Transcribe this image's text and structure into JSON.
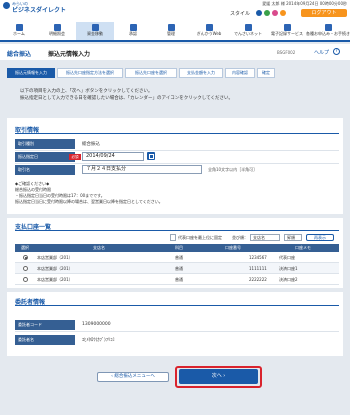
{
  "brand": {
    "sub": "みらいの",
    "name": "ビジネスダイレクト"
  },
  "header": {
    "user_info": "愛媛 太郎 様 2014年09月24日 00時00分00秒",
    "style_label": "スタイル",
    "logout": "ログアウト"
  },
  "nav": [
    {
      "label": "ホーム"
    },
    {
      "label": "明細照会"
    },
    {
      "label": "資金移動"
    },
    {
      "label": "承認"
    },
    {
      "label": "管理"
    },
    {
      "label": "ぎんかうWeb"
    },
    {
      "label": "でんさいネット"
    },
    {
      "label": "電子記録サービス"
    },
    {
      "label": "各種お申込み・お手続き"
    }
  ],
  "page": {
    "section": "総合振込",
    "title": "振込元情報入力",
    "code": "BSGF002",
    "help": "ヘルプ",
    "help_symbol": "?"
  },
  "steps": [
    "振込元情報を入力",
    "振込先口座指定方法を選択",
    "振込先口座を選択",
    "支払金額を入力",
    "内容確認",
    "確定"
  ],
  "instructions": [
    "以下の項目を入力の上、「次へ」ボタンをクリックしてください。",
    "振込指定日として入力できる日を確認したい場合は、「カレンダー」のアイコンをクリックしてください。"
  ],
  "transaction": {
    "title": "取引情報",
    "type_label": "取引種別",
    "type_value": "総合振込",
    "date_label": "振込指定日",
    "required": "必須",
    "date_value": "2014/09/24",
    "name_label": "取引名",
    "name_value": "７月２４日支払分",
    "name_hint": "全角10文字以内［半角可］"
  },
  "notes": [
    "◆ご確認ください◆",
    "総合振込の受付時限",
    "・振込指定日当日の受付時限は17：00までです。",
    "振込指定日当日に受付時限以降の場合は、翌営業日以降を指定日としてください。"
  ],
  "account_list": {
    "title": "支払口座一覧",
    "checkbox_label": "代表口座を最上位に固定",
    "sort_label": "並び順：",
    "sort_value": "支店名",
    "order_value": "昇順",
    "resort": "再表示",
    "columns": [
      "選択",
      "支店名",
      "科目",
      "口座番号",
      "口座メモ"
    ],
    "rows": [
      {
        "branch": "本店営業部（201）",
        "subject": "普通",
        "number": "1234567",
        "memo": "代表口座"
      },
      {
        "branch": "本店営業部（201）",
        "subject": "普通",
        "number": "1111111",
        "memo": "決済口座1"
      },
      {
        "branch": "本店営業部（201）",
        "subject": "普通",
        "number": "2222222",
        "memo": "決済口座2"
      }
    ]
  },
  "consignor": {
    "title": "委託者情報",
    "code_label": "委託者コード",
    "code_value": "1309000000",
    "name_label": "委託者名",
    "name_value": "ｴﾋﾒﾀﾛｳ(ｶﾌﾞ)ﾌﾘｺﾐ"
  },
  "buttons": {
    "back": "総合振込メニューへ",
    "next": "次へ"
  },
  "colors": {
    "brand": "#1a5aa8",
    "logout": "#f7941d",
    "highlight": "#d9232d"
  }
}
